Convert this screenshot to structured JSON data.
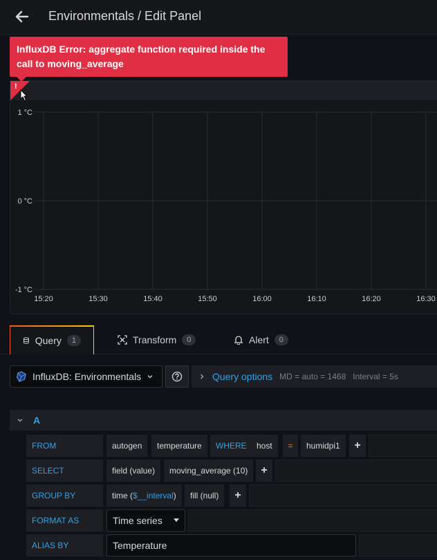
{
  "header": {
    "title": "Environmentals / Edit Panel"
  },
  "panel": {
    "error_message": "InfluxDB Error: aggregate function required inside the call to moving_average",
    "error_mark": "!"
  },
  "chart_data": {
    "type": "line",
    "y_ticks": [
      "1 °C",
      "0 °C",
      "-1 °C"
    ],
    "x_ticks": [
      "15:20",
      "15:30",
      "15:40",
      "15:50",
      "16:00",
      "16:10",
      "16:20",
      "16:30"
    ],
    "series": [],
    "grid": true
  },
  "tabs": [
    {
      "label": "Query",
      "count": "1",
      "icon": "database-icon"
    },
    {
      "label": "Transform",
      "count": "0",
      "icon": "transform-icon"
    },
    {
      "label": "Alert",
      "count": "0",
      "icon": "bell-icon"
    }
  ],
  "datasource": {
    "name": "InfluxDB: Environmentals"
  },
  "query_options": {
    "title": "Query options",
    "md": "MD = auto = 1468",
    "interval": "Interval = 5s"
  },
  "query": {
    "letter": "A",
    "from": {
      "label": "FROM",
      "policy": "autogen",
      "measurement": "temperature",
      "where_kw": "WHERE",
      "tag": "host",
      "operator": "=",
      "value": "humidpi1"
    },
    "select": {
      "label": "SELECT",
      "field": "field (value)",
      "fn": "moving_average (10)"
    },
    "group_by": {
      "label": "GROUP BY",
      "time_prefix": "time (",
      "time_var": "$__interval",
      "time_suffix": ")",
      "fill": "fill (null)"
    },
    "format_as": {
      "label": "FORMAT AS",
      "value": "Time series"
    },
    "alias_by": {
      "label": "ALIAS BY",
      "value": "Temperature"
    }
  },
  "colors": {
    "error": "#e02f44",
    "accent": "#33a2e5",
    "operator": "#eb7b18"
  }
}
